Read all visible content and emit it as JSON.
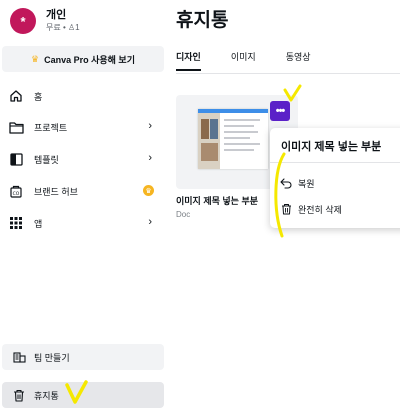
{
  "profile": {
    "avatar_letter": "*",
    "name": "개인",
    "subtitle": "무료 • ♙1"
  },
  "sidebar": {
    "pro_button_label": "Canva Pro 사용해 보기",
    "items": [
      {
        "label": "홈",
        "icon": "home-icon"
      },
      {
        "label": "프로젝트",
        "icon": "folder-icon"
      },
      {
        "label": "템플릿",
        "icon": "template-icon"
      },
      {
        "label": "브랜드 허브",
        "icon": "brand-hub-icon"
      },
      {
        "label": "앱",
        "icon": "apps-grid-icon"
      }
    ],
    "team_button_label": "팀 만들기",
    "trash_button_label": "휴지통"
  },
  "main": {
    "title": "휴지통",
    "tabs": [
      {
        "label": "디자인",
        "active": true
      },
      {
        "label": "이미지",
        "active": false
      },
      {
        "label": "동영상",
        "active": false
      }
    ]
  },
  "design_card": {
    "title": "이미지 제목 넣는 부분",
    "type": "Doc",
    "more_label": "•••"
  },
  "context_menu": {
    "title": "이미지 제목 넣는 부분",
    "items": [
      {
        "label": "복원",
        "icon": "restore-icon"
      },
      {
        "label": "완전히 삭제",
        "icon": "trash-icon"
      }
    ]
  },
  "colors": {
    "avatar": "#c1185b",
    "accent_purple": "#5b21c8",
    "crown_gold": "#f6b521",
    "annotation_yellow": "#f5e800"
  }
}
